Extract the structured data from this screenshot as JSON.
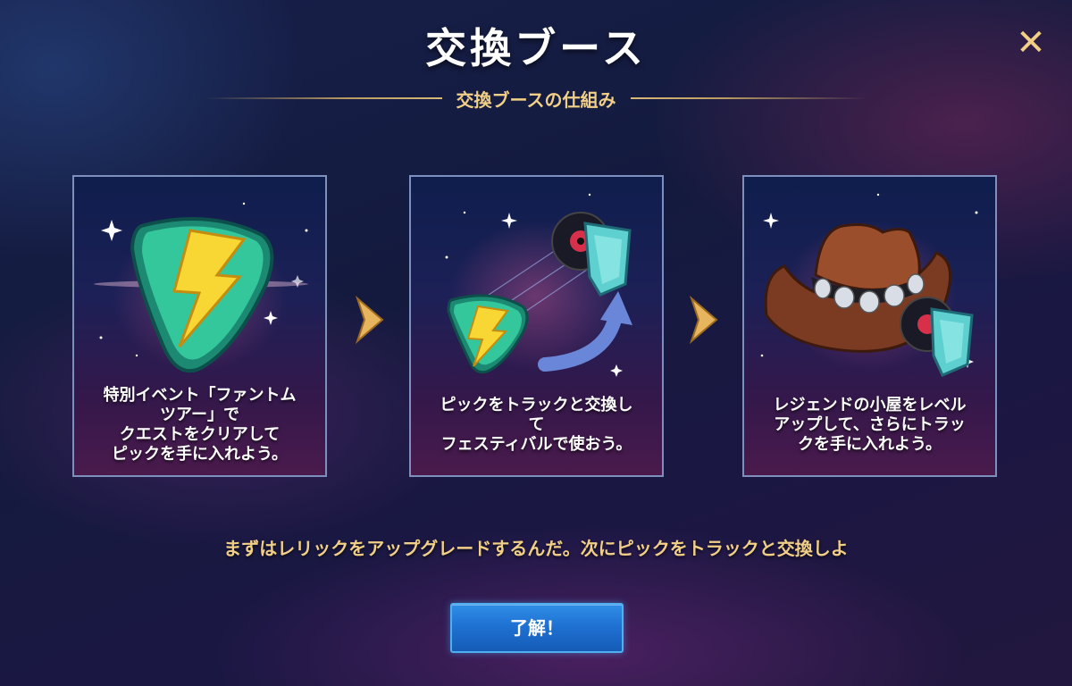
{
  "header": {
    "title": "交換ブース",
    "subtitle": "交換ブースの仕組み"
  },
  "close_icon": "✕",
  "steps": [
    {
      "caption_lines": [
        "特別イベント「ファントム",
        "ツアー」で",
        "クエストをクリアして",
        "ピックを手に入れよう。"
      ],
      "icon": "guitar-pick-lightning-icon"
    },
    {
      "caption_lines": [
        "ピックをトラックと交換し",
        "て",
        "フェスティバルで使おう。"
      ],
      "icon": "pick-to-track-exchange-icon"
    },
    {
      "caption_lines": [
        "レジェンドの小屋をレベル",
        "アップして、さらにトラッ",
        "クを手に入れよう。"
      ],
      "icon": "cowboy-hat-icon"
    }
  ],
  "message": "まずはレリックをアップグレードするんだ。次にピックをトラックと交換しよ",
  "ok_button": {
    "label": "了解！"
  },
  "colors": {
    "accent_gold": "#f1cf87",
    "button_blue": "#1e6fd0"
  }
}
